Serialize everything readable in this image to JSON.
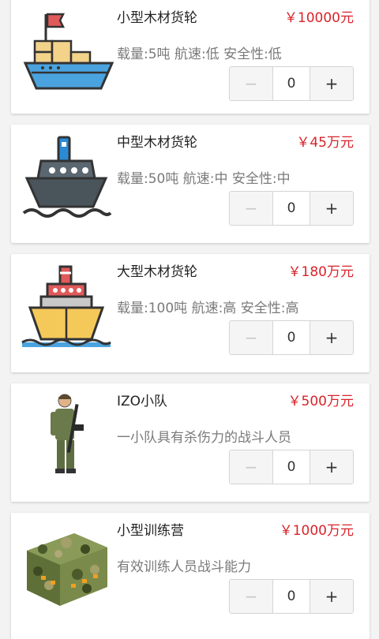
{
  "products": [
    {
      "name": "小型木材货轮",
      "price": "￥10000元",
      "desc": "载量:5吨 航速:低 安全性:低",
      "qty": "0",
      "icon": "small-cargo-ship-icon",
      "minus": "−",
      "plus": "+"
    },
    {
      "name": "中型木材货轮",
      "price": "￥45万元",
      "desc": "载量:50吨 航速:中 安全性:中",
      "qty": "0",
      "icon": "medium-cargo-ship-icon",
      "minus": "−",
      "plus": "+"
    },
    {
      "name": "大型木材货轮",
      "price": "￥180万元",
      "desc": "载量:100吨 航速:高 安全性:高",
      "qty": "0",
      "icon": "large-cargo-ship-icon",
      "minus": "−",
      "plus": "+"
    },
    {
      "name": "IZO小队",
      "price": "￥500万元",
      "desc": "一小队具有杀伤力的战斗人员",
      "qty": "0",
      "icon": "soldier-icon",
      "minus": "−",
      "plus": "+"
    },
    {
      "name": "小型训练营",
      "price": "￥1000万元",
      "desc": "有效训练人员战斗能力",
      "qty": "0",
      "icon": "camo-tent-icon",
      "minus": "−",
      "plus": "+"
    }
  ],
  "colors": {
    "price": "#d9232a",
    "text": "#222222",
    "muted": "#7a7a7a",
    "background": "#f3f3f3"
  }
}
